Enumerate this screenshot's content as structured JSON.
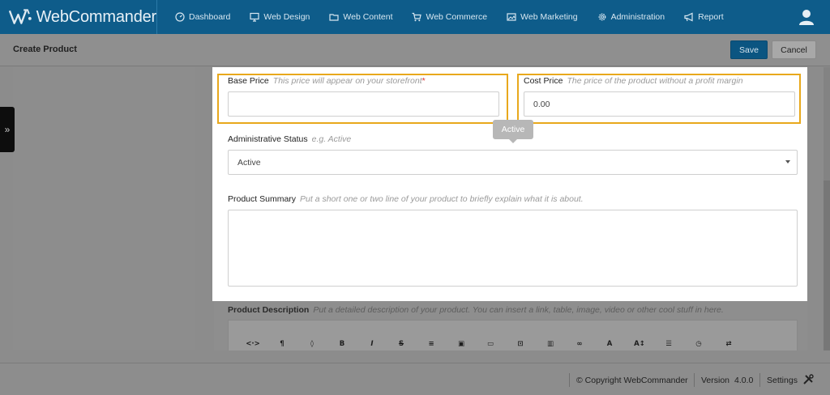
{
  "app": {
    "name": "WebCommander",
    "brand_color": "#0e5c8a",
    "highlight_color": "#e8a81c"
  },
  "nav": {
    "items": [
      {
        "label": "Dashboard",
        "icon": "dashboard-icon"
      },
      {
        "label": "Web Design",
        "icon": "monitor-icon"
      },
      {
        "label": "Web Content",
        "icon": "folder-icon"
      },
      {
        "label": "Web Commerce",
        "icon": "cart-icon"
      },
      {
        "label": "Web Marketing",
        "icon": "image-icon"
      },
      {
        "label": "Administration",
        "icon": "gear-icon"
      },
      {
        "label": "Report",
        "icon": "megaphone-icon"
      }
    ]
  },
  "page": {
    "title": "Create Product",
    "save_label": "Save",
    "cancel_label": "Cancel"
  },
  "form": {
    "base_price": {
      "label": "Base Price",
      "hint": "This price will appear on your storefront",
      "required_mark": "*",
      "value": ""
    },
    "cost_price": {
      "label": "Cost Price",
      "hint": "The price of the product without a profit margin",
      "value": "0.00"
    },
    "tooltip": "Active",
    "admin_status": {
      "label": "Administrative Status",
      "hint": "e.g. Active",
      "value": "Active"
    },
    "summary": {
      "label": "Product Summary",
      "hint": "Put a short one or two line of your product to briefly explain what it is about."
    },
    "description": {
      "label": "Product Description",
      "hint": "Put a detailed description of your product. You can insert a link, table, image, video or other cool stuff in here."
    }
  },
  "editor_toolbar": [
    {
      "name": "code-view-icon",
      "glyph": "<·>"
    },
    {
      "name": "paragraph-icon",
      "glyph": "¶"
    },
    {
      "name": "color-drop-icon",
      "glyph": "◊"
    },
    {
      "name": "bold-icon",
      "glyph": "B"
    },
    {
      "name": "italic-icon",
      "glyph": "I"
    },
    {
      "name": "strikethrough-icon",
      "glyph": "S"
    },
    {
      "name": "list-icon",
      "glyph": "≡"
    },
    {
      "name": "insert-image-icon",
      "glyph": "▣"
    },
    {
      "name": "insert-video-icon",
      "glyph": "▭"
    },
    {
      "name": "insert-media-icon",
      "glyph": "⊡"
    },
    {
      "name": "table-icon",
      "glyph": "▥"
    },
    {
      "name": "link-icon",
      "glyph": "∞"
    },
    {
      "name": "font-color-icon",
      "glyph": "A"
    },
    {
      "name": "font-size-icon",
      "glyph": "A↕"
    },
    {
      "name": "align-icon",
      "glyph": "☰"
    },
    {
      "name": "clock-icon",
      "glyph": "◷"
    },
    {
      "name": "settings-sliders-icon",
      "glyph": "⇄"
    }
  ],
  "footer": {
    "copyright": "© Copyright WebCommander",
    "version_label": "Version",
    "version": "4.0.0",
    "settings_label": "Settings"
  }
}
